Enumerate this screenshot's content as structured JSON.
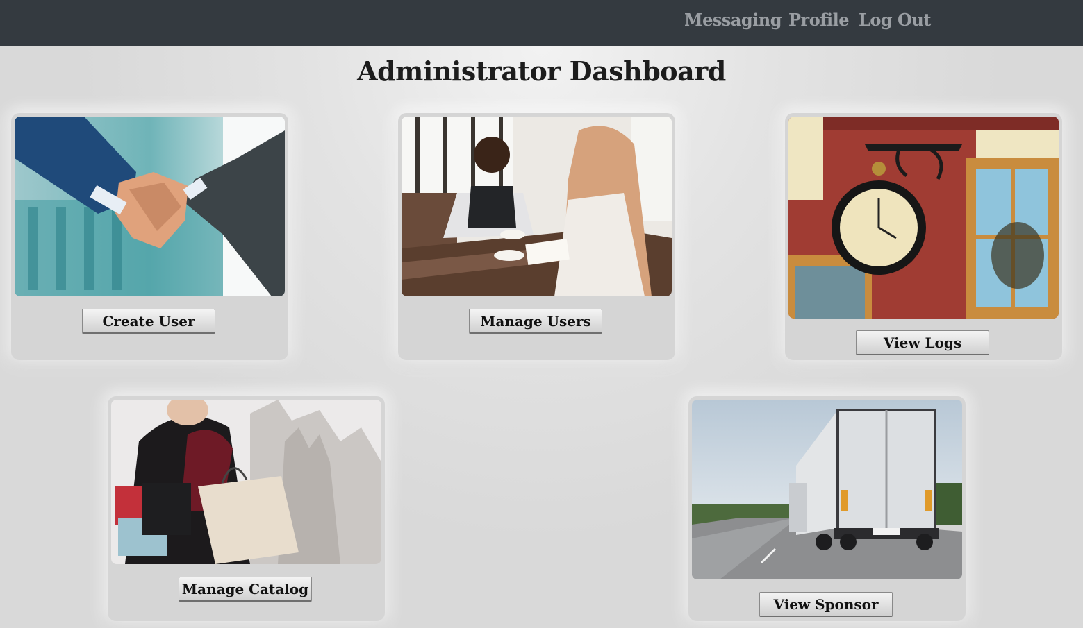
{
  "nav": {
    "messaging": "Messaging",
    "profile": "Profile",
    "logout": "Log Out"
  },
  "page": {
    "title": "Administrator Dashboard"
  },
  "cards": [
    {
      "image": "handshake-photo",
      "button": "Create User"
    },
    {
      "image": "meeting-photo",
      "button": "Manage Users"
    },
    {
      "image": "clock-photo",
      "button": "View Logs"
    },
    {
      "image": "shopping-photo",
      "button": "Manage Catalog"
    },
    {
      "image": "truck-photo",
      "button": "View Sponsor"
    }
  ],
  "colors": {
    "navbar": "#343a40",
    "nav_link": "#9a9ea3",
    "card": "#d5d5d5",
    "background": "#d9d9d9"
  }
}
